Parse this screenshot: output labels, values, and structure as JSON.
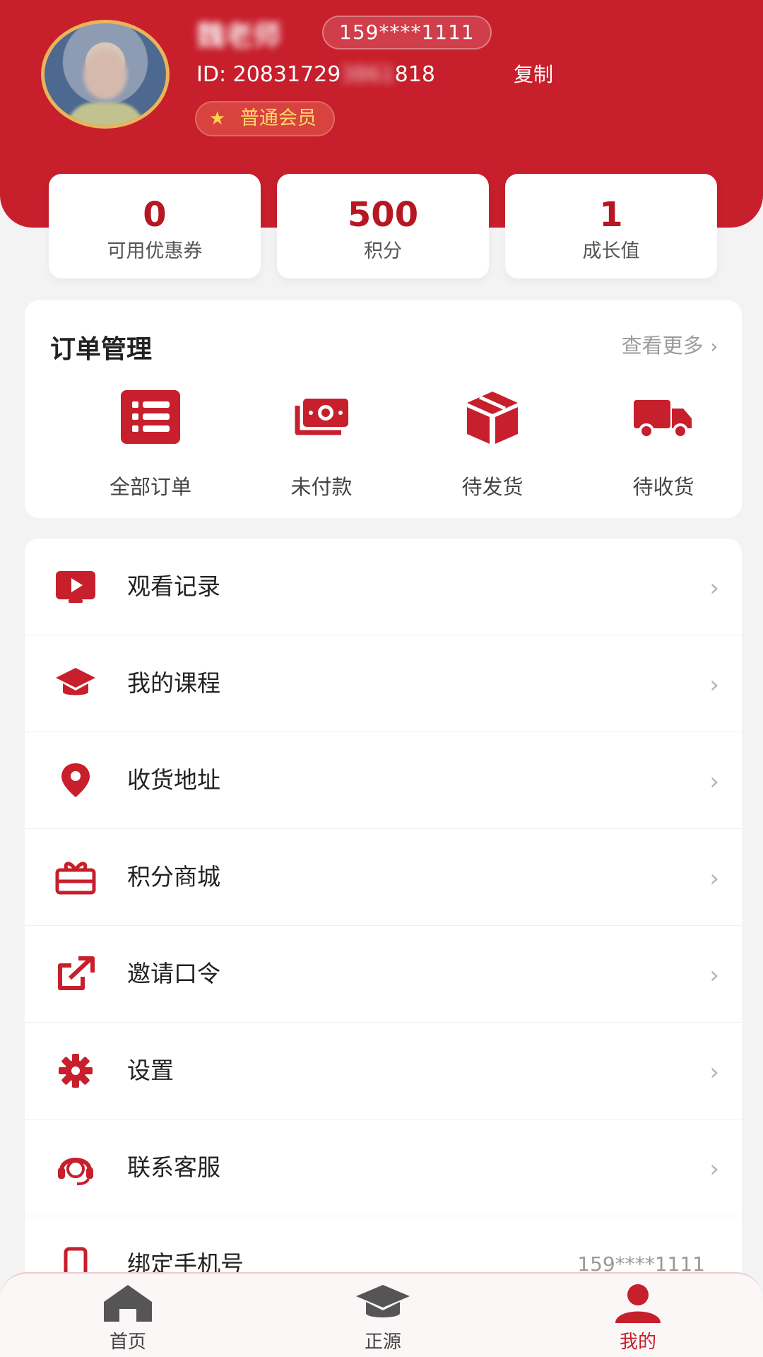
{
  "colors": {
    "brand_red": "#c71f2c",
    "accent_red": "#b71722",
    "page_bg": "#f4f3f4",
    "badge_gold": "#ffd76a"
  },
  "profile": {
    "username": "魏老师",
    "phone": "159****1111",
    "id_label": "ID:",
    "id_prefix": "20831729",
    "id_hidden": "3861",
    "id_suffix": "818",
    "copy_label": "复制",
    "member_badge": "普通会员",
    "member_icon": "star-icon"
  },
  "stats": [
    {
      "value": "0",
      "label": "可用优惠券"
    },
    {
      "value": "500",
      "label": "积分"
    },
    {
      "value": "1",
      "label": "成长值"
    }
  ],
  "orders": {
    "title": "订单管理",
    "more_label": "查看更多",
    "items": [
      {
        "label": "全部订单",
        "icon": "list-icon"
      },
      {
        "label": "未付款",
        "icon": "cash-icon"
      },
      {
        "label": "待发货",
        "icon": "package-icon"
      },
      {
        "label": "待收货",
        "icon": "truck-icon"
      }
    ]
  },
  "menu": {
    "items": [
      {
        "label": "观看记录",
        "icon": "play-icon"
      },
      {
        "label": "我的课程",
        "icon": "graduation-cap-icon"
      },
      {
        "label": "收货地址",
        "icon": "location-pin-icon"
      },
      {
        "label": "积分商城",
        "icon": "gift-box-icon"
      },
      {
        "label": "邀请口令",
        "icon": "share-icon"
      },
      {
        "label": "设置",
        "icon": "gear-icon"
      },
      {
        "label": "联系客服",
        "icon": "headset-icon"
      },
      {
        "label": "绑定手机号",
        "icon": "phone-icon",
        "value": "159****1111"
      }
    ]
  },
  "tabbar": {
    "items": [
      {
        "label": "首页",
        "icon": "home-icon"
      },
      {
        "label": "正源",
        "icon": "graduation-cap-icon"
      },
      {
        "label": "我的",
        "icon": "person-icon",
        "active": true
      }
    ]
  }
}
